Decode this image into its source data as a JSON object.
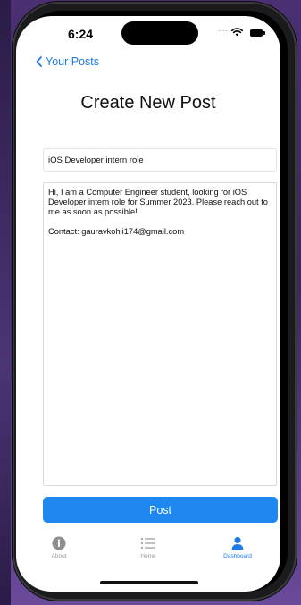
{
  "status_bar": {
    "time": "6:24",
    "signal": "....",
    "icons": [
      "wifi-icon",
      "battery-icon"
    ]
  },
  "nav": {
    "back_label": "Your Posts",
    "back_icon": "chevron-left-icon"
  },
  "page": {
    "title": "Create New Post"
  },
  "form": {
    "title_value": "iOS Developer intern role",
    "body_value": "Hi, I am a Computer Engineer student, looking for iOS Developer intern role for Summer 2023. Please reach out to me as soon as possible!\n\nContact: gauravkohli174@gmail.com",
    "submit_label": "Post"
  },
  "tab_bar": {
    "items": [
      {
        "label": "About",
        "icon": "info-circle-icon",
        "active": false
      },
      {
        "label": "Home",
        "icon": "list-icon",
        "active": false
      },
      {
        "label": "Dashboard",
        "icon": "person-icon",
        "active": true
      }
    ]
  },
  "colors": {
    "accent": "#1f7ae6",
    "button": "#1e87f0",
    "inactive": "#9a9a9a",
    "background_wallpaper": "#4b2f73"
  }
}
